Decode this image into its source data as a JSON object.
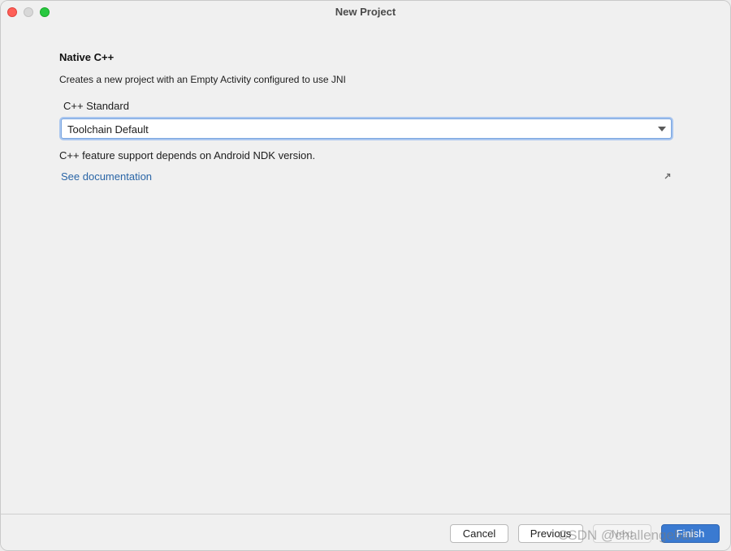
{
  "window": {
    "title": "New Project"
  },
  "content": {
    "heading": "Native C++",
    "description": "Creates a new project with an Empty Activity configured to use JNI",
    "cpp_standard_label": "C++ Standard",
    "cpp_standard_value": "Toolchain Default",
    "note": "C++ feature support depends on Android NDK version.",
    "doc_link": "See documentation",
    "doc_link_icon": "external-link-icon"
  },
  "footer": {
    "cancel": "Cancel",
    "previous": "Previous",
    "next": "Next",
    "finish": "Finish"
  },
  "watermark": "CSDN @challengeball",
  "colors": {
    "accent": "#3a7ad1",
    "link": "#2a65a6",
    "close": "#fe5f57",
    "maximize": "#28c840"
  }
}
